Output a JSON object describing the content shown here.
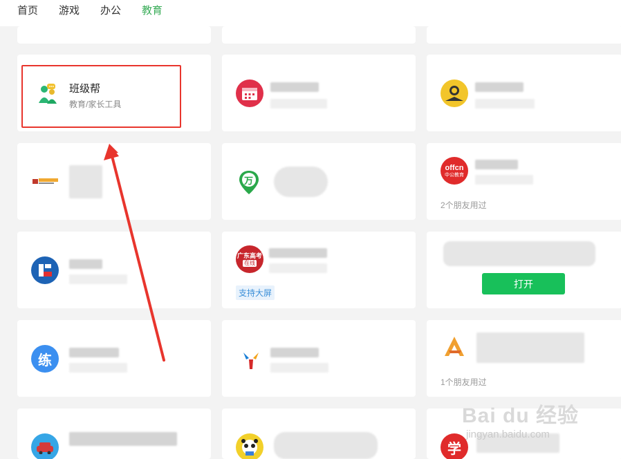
{
  "nav": {
    "tabs": [
      "首页",
      "游戏",
      "办公",
      "教育"
    ],
    "active": "教育"
  },
  "featured": {
    "name": "班级帮",
    "category": "教育/家长工具"
  },
  "icons": {
    "wan": "万",
    "offcn_top": "offcn",
    "offcn_bottom": "中公教育",
    "gdgk_top": "广东高考",
    "gdgk_bottom": "在线",
    "lian": "练",
    "xue": "学"
  },
  "meta": {
    "offcn_friends": "2个朋友用过",
    "tag_bigscreen": "支持大屏",
    "open_button": "打开",
    "a_friends": "1个朋友用过"
  },
  "watermark": {
    "main": "Bai du 经验",
    "url": "jingyan.baidu.com"
  },
  "colors": {
    "active_tab": "#3aad59",
    "open_button": "#18c05a",
    "highlight": "#e8352d",
    "tag_text": "#3b8fd8"
  }
}
